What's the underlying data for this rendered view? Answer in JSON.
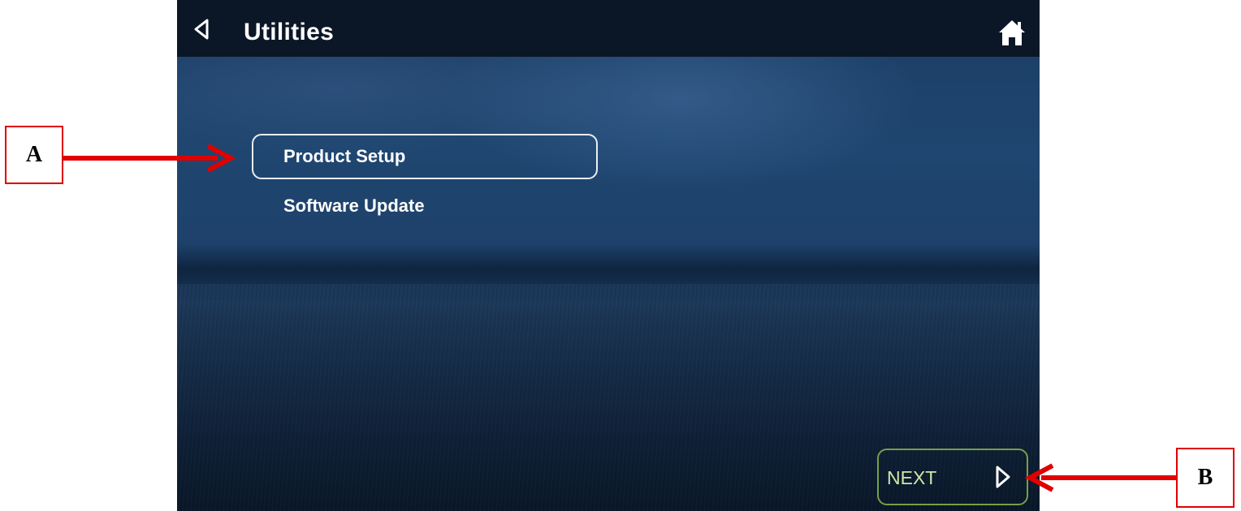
{
  "header": {
    "title": "Utilities"
  },
  "icons": {
    "back": "chevron-left-outline-icon",
    "home": "home-icon",
    "next": "chevron-right-outline-icon"
  },
  "menu": {
    "items": [
      {
        "label": "Product Setup",
        "selected": true
      },
      {
        "label": "Software Update",
        "selected": false
      }
    ]
  },
  "footer": {
    "next_label": "NEXT"
  },
  "annotations": {
    "a_label": "A",
    "b_label": "B"
  },
  "colors": {
    "topbar": "#0b1626",
    "background": "#1d406a",
    "selection_border": "#e9eef3",
    "next_border": "#76a046",
    "next_text": "#cfe6a8",
    "annotation_red": "#e00000"
  }
}
